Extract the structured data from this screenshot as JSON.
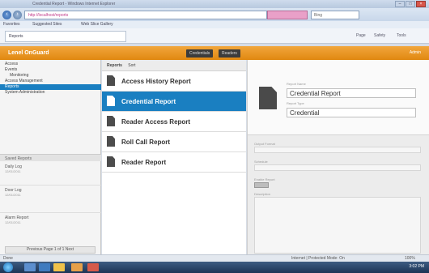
{
  "browser": {
    "title": "Credential Report - Windows Internet Explorer",
    "url": "http://localhost/reports",
    "search_placeholder": "Bing",
    "favorites": [
      "Favorites",
      "Suggested Sites",
      "Web Slice Gallery"
    ],
    "tab_label": "Reports",
    "commands": [
      "Page",
      "Safety",
      "Tools"
    ],
    "win_controls": [
      "–",
      "□",
      "×"
    ]
  },
  "app": {
    "logo": "Lenel OnGuard",
    "header_buttons": [
      "Credentials",
      "Readers"
    ],
    "user": "Admin",
    "status_left": "Done",
    "status_right": "Internet | Protected Mode: On",
    "zoom": "100%",
    "clock": "3:02 PM"
  },
  "tree": [
    {
      "label": "Access",
      "selected": false,
      "child": false
    },
    {
      "label": "Events",
      "selected": false,
      "child": false
    },
    {
      "label": "Monitoring",
      "selected": false,
      "child": true
    },
    {
      "label": "Access Management",
      "selected": false,
      "child": false
    },
    {
      "label": "Reports",
      "selected": true,
      "child": false
    },
    {
      "label": "System Administration",
      "selected": false,
      "child": false
    }
  ],
  "saved": {
    "header": "Saved Reports",
    "items": [
      {
        "title": "Daily Log",
        "sub": "12/01/2011"
      },
      {
        "title": "Door Log",
        "sub": "12/01/2011"
      },
      {
        "title": "Alarm Report",
        "sub": "12/01/2011"
      }
    ],
    "pager": "Previous  Page 1 of 1  Next"
  },
  "center": {
    "head_label": "Reports",
    "head_sub": "Sort",
    "reports": [
      {
        "label": "Access History Report",
        "active": false
      },
      {
        "label": "Credential Report",
        "active": true
      },
      {
        "label": "Reader Access Report",
        "active": false
      },
      {
        "label": "Roll Call Report",
        "active": false
      },
      {
        "label": "Reader Report",
        "active": false
      }
    ]
  },
  "detail": {
    "name_label": "Report Name",
    "name_value": "Credential Report",
    "type_label": "Report Type",
    "type_value": "Credential",
    "settings_labels": [
      "Output Format",
      "Schedule",
      "Enable Report",
      "Description"
    ]
  }
}
